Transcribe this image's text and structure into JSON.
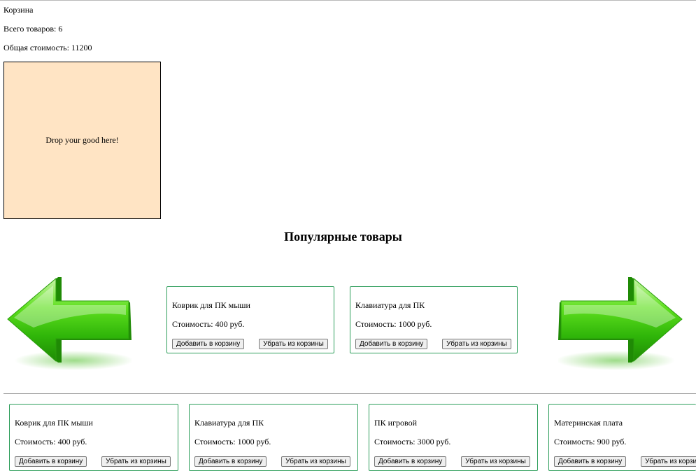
{
  "cart": {
    "title": "Корзина",
    "count_text": "Всего товаров: 6",
    "total_text": "Общая стоимость: 11200",
    "drop_text": "Drop your good here!"
  },
  "popular": {
    "title": "Популярные товары",
    "left_arrow_icon": "arrow-left-icon",
    "right_arrow_icon": "arrow-right-icon",
    "items": [
      {
        "name": "Коврик для ПК мыши",
        "price": "Стоимость: 400 руб.",
        "add": "Добавить в корзину",
        "remove": "Убрать из корзины"
      },
      {
        "name": "Клавиатура для ПК",
        "price": "Стоимость: 1000 руб.",
        "add": "Добавить в корзину",
        "remove": "Убрать из корзины"
      }
    ]
  },
  "catalog": {
    "items": [
      {
        "name": "Коврик для ПК мыши",
        "price": "Стоимость: 400 руб.",
        "add": "Добавить в корзину",
        "remove": "Убрать из корзины"
      },
      {
        "name": "Клавиатура для ПК",
        "price": "Стоимость: 1000 руб.",
        "add": "Добавить в корзину",
        "remove": "Убрать из корзины"
      },
      {
        "name": "ПК игровой",
        "price": "Стоимость: 3000 руб.",
        "add": "Добавить в корзину",
        "remove": "Убрать из корзины"
      },
      {
        "name": "Материнская плата",
        "price": "Стоимость: 900 руб.",
        "add": "Добавить в корзину",
        "remove": "Убрать из корзины"
      }
    ]
  },
  "colors": {
    "drop_zone_bg": "#ffe4c4",
    "card_border": "#2e9e5b",
    "arrow_green": "#35c90e"
  }
}
